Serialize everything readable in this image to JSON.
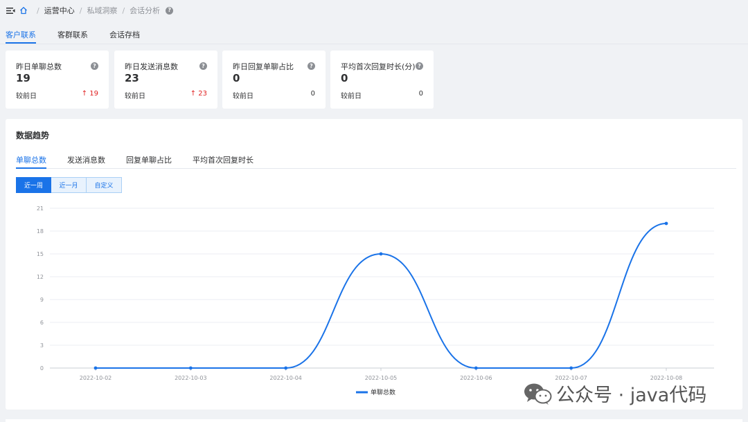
{
  "breadcrumb": {
    "items": [
      "运营中心",
      "私域洞察",
      "会话分析"
    ],
    "separator": "/",
    "help_icon": "?"
  },
  "top_tabs": [
    {
      "label": "客户联系",
      "active": true
    },
    {
      "label": "客群联系",
      "active": false
    },
    {
      "label": "会话存档",
      "active": false
    }
  ],
  "stats": [
    {
      "title": "昨日单聊总数",
      "value": "19",
      "compare_label": "较前日",
      "compare_value": "19",
      "trend": "up",
      "arrow": "↑"
    },
    {
      "title": "昨日发送消息数",
      "value": "23",
      "compare_label": "较前日",
      "compare_value": "23",
      "trend": "up",
      "arrow": "↑"
    },
    {
      "title": "昨日回复单聊占比",
      "value": "0",
      "compare_label": "较前日",
      "compare_value": "0",
      "trend": "none",
      "arrow": ""
    },
    {
      "title": "平均首次回复时长(分)",
      "value": "0",
      "compare_label": "较前日",
      "compare_value": "0",
      "trend": "none",
      "arrow": ""
    }
  ],
  "trend": {
    "title": "数据趋势",
    "tabs": [
      {
        "label": "单聊总数",
        "active": true
      },
      {
        "label": "发送消息数",
        "active": false
      },
      {
        "label": "回复单聊占比",
        "active": false
      },
      {
        "label": "平均首次回复时长",
        "active": false
      }
    ],
    "ranges": [
      {
        "label": "近一周",
        "active": true
      },
      {
        "label": "近一月",
        "active": false
      },
      {
        "label": "自定义",
        "active": false
      }
    ]
  },
  "chart_data": {
    "type": "line",
    "categories": [
      "2022-10-02",
      "2022-10-03",
      "2022-10-04",
      "2022-10-05",
      "2022-10-06",
      "2022-10-07",
      "2022-10-08"
    ],
    "series": [
      {
        "name": "单聊总数",
        "values": [
          0,
          0,
          0,
          15,
          0,
          0,
          19
        ]
      }
    ],
    "yticks": [
      0,
      3,
      6,
      9,
      12,
      15,
      18,
      21
    ],
    "ylim": [
      0,
      21
    ],
    "smooth": true,
    "grid": true,
    "legend_position": "bottom",
    "line_color": "#1a73e8"
  },
  "watermark": {
    "text": "公众号 · java代码"
  },
  "colors": {
    "accent": "#1a73e8",
    "up": "#e02020",
    "background": "#f0f2f5"
  }
}
